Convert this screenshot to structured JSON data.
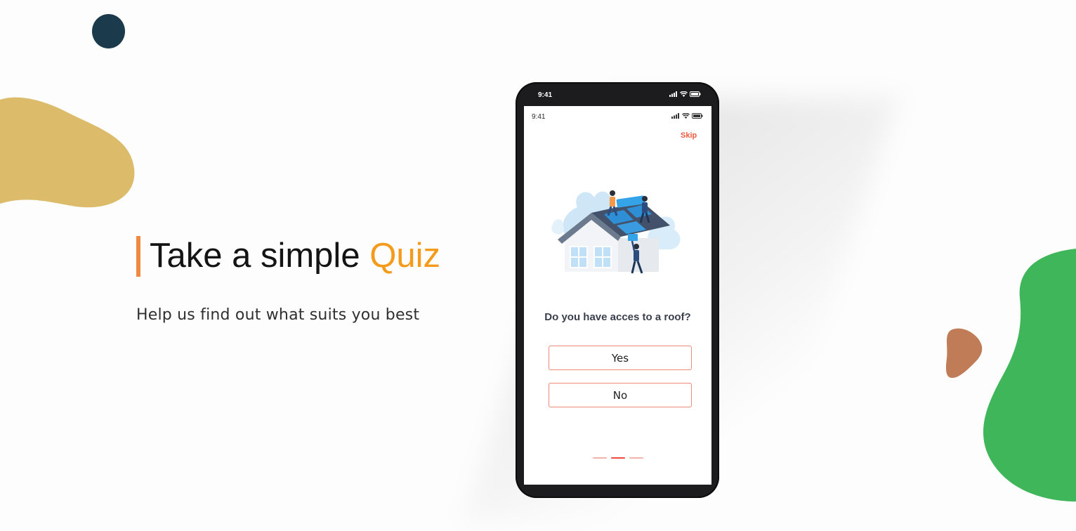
{
  "hero": {
    "title_main": "Take a simple ",
    "title_accent": "Quiz",
    "subtitle": "Help us find out what suits you best"
  },
  "phone": {
    "outer_time": "9:41",
    "screen_time": "9:41",
    "skip_label": "Skip",
    "question": "Do you have acces to a roof?",
    "answers": [
      "Yes",
      "No"
    ],
    "progress": {
      "total_steps": 3,
      "current_step": 2
    }
  },
  "colors": {
    "accent_orange": "#f59b1b",
    "bar_orange": "#f08a43",
    "skip_red": "#ef5a3f",
    "button_border": "#ee8a78",
    "blob_yellow": "#dcbb6b",
    "blob_green": "#3fb65a",
    "blob_brown": "#c07b57",
    "dot_navy": "#1b3a4b"
  },
  "icons": [
    "signal-icon",
    "wifi-icon",
    "battery-icon"
  ]
}
